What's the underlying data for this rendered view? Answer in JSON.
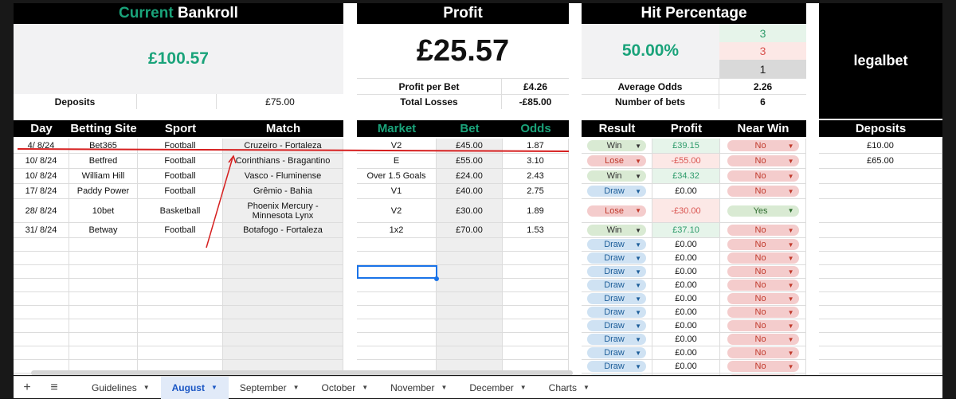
{
  "summary": {
    "bankroll_title_part1": "Current",
    "bankroll_title_part2": "Bankroll",
    "bankroll_value": "£100.57",
    "deposits_label": "Deposits",
    "deposits_value": "£75.00",
    "profit_title": "Profit",
    "profit_value": "£25.57",
    "profit_per_bet_label": "Profit per Bet",
    "profit_per_bet_value": "£4.26",
    "total_losses_label": "Total Losses",
    "total_losses_value": "-£85.00",
    "hit_title": "Hit Percentage",
    "hit_value": "50.00%",
    "hit_wins": "3",
    "hit_losses": "3",
    "hit_draws": "1",
    "avg_odds_label": "Average Odds",
    "avg_odds_value": "2.26",
    "num_bets_label": "Number of bets",
    "num_bets_value": "6",
    "brand": "legalbet"
  },
  "headers": {
    "day": "Day",
    "site": "Betting Site",
    "sport": "Sport",
    "match": "Match",
    "market": "Market",
    "bet": "Bet",
    "odds": "Odds",
    "result": "Result",
    "profit": "Profit",
    "near_win": "Near Win",
    "deposits": "Deposits"
  },
  "bets": [
    {
      "day": "4/ 8/24",
      "site": "Bet365",
      "sport": "Football",
      "match": "Cruzeiro - Fortaleza",
      "market": "V2",
      "bet": "£45.00",
      "odds": "1.87",
      "result": "Win",
      "profit": "£39.15",
      "near": "No"
    },
    {
      "day": "10/ 8/24",
      "site": "Betfred",
      "sport": "Football",
      "match": "Corinthians - Bragantino",
      "market": "E",
      "bet": "£55.00",
      "odds": "3.10",
      "result": "Lose",
      "profit": "-£55.00",
      "near": "No"
    },
    {
      "day": "10/ 8/24",
      "site": "William Hill",
      "sport": "Football",
      "match": "Vasco - Fluminense",
      "market": "Over 1.5 Goals",
      "bet": "£24.00",
      "odds": "2.43",
      "result": "Win",
      "profit": "£34.32",
      "near": "No"
    },
    {
      "day": "17/ 8/24",
      "site": "Paddy Power",
      "sport": "Football",
      "match": "Grêmio - Bahia",
      "market": "V1",
      "bet": "£40.00",
      "odds": "2.75",
      "result": "Draw",
      "profit": "£0.00",
      "near": "No"
    },
    {
      "day": "28/ 8/24",
      "site": "10bet",
      "sport": "Basketball",
      "match": "Phoenix Mercury - Minnesota Lynx",
      "market": "V2",
      "bet": "£30.00",
      "odds": "1.89",
      "result": "Lose",
      "profit": "-£30.00",
      "near": "Yes"
    },
    {
      "day": "31/ 8/24",
      "site": "Betway",
      "sport": "Football",
      "match": "Botafogo - Fortaleza",
      "market": "1x2",
      "bet": "£70.00",
      "odds": "1.53",
      "result": "Win",
      "profit": "£37.10",
      "near": "No"
    }
  ],
  "empty_rows": {
    "result": "Draw",
    "profit": "£0.00",
    "near": "No"
  },
  "deposit_entries": [
    "£10.00",
    "£65.00"
  ],
  "tabs": [
    "Guidelines",
    "August",
    "September",
    "October",
    "November",
    "December",
    "Charts"
  ],
  "active_tab": "August",
  "colors": {
    "accent_green": "#1aa37a",
    "loss_red": "#e0333a",
    "header_black": "#000000",
    "selection_blue": "#1a56c4"
  }
}
